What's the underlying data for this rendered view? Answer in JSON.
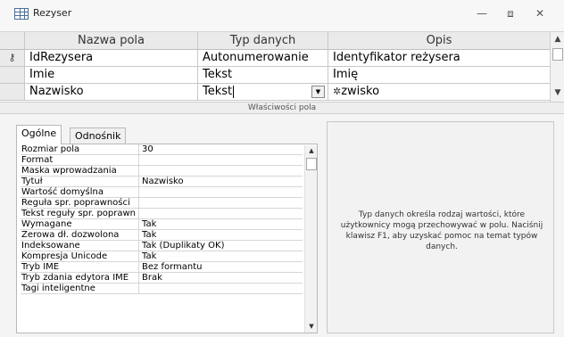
{
  "window": {
    "title": "Rezyser",
    "minimize_glyph": "—",
    "restore_glyph": "⧈",
    "close_glyph": "✕"
  },
  "grid": {
    "headers": [
      "Nazwa pola",
      "Typ danych",
      "Opis"
    ],
    "rows": [
      {
        "key_glyph": "🗝",
        "name": "IdRezysera",
        "type": "Autonumerowanie",
        "desc": "Identyfikator reżysera"
      },
      {
        "key_glyph": "",
        "name": "Imie",
        "type": "Tekst",
        "desc": "Imię"
      },
      {
        "key_glyph": "",
        "name": "Nazwisko",
        "type": "Tekst",
        "desc": "zwisko",
        "desc_prefix_glyph": "✲"
      }
    ]
  },
  "properties_label": "Właściwości pola",
  "tabs": [
    "Ogólne",
    "Odnośnik"
  ],
  "properties": [
    {
      "name": "Rozmiar pola",
      "value": "30"
    },
    {
      "name": "Format",
      "value": ""
    },
    {
      "name": "Maska wprowadzania",
      "value": ""
    },
    {
      "name": "Tytuł",
      "value": "Nazwisko"
    },
    {
      "name": "Wartość domyślna",
      "value": ""
    },
    {
      "name": "Reguła spr. poprawności",
      "value": ""
    },
    {
      "name": "Tekst reguły spr. poprawn",
      "value": ""
    },
    {
      "name": "Wymagane",
      "value": "Tak"
    },
    {
      "name": "Zerowa dł. dozwolona",
      "value": "Tak"
    },
    {
      "name": "Indeksowane",
      "value": "Tak (Duplikaty OK)"
    },
    {
      "name": "Kompresja Unicode",
      "value": "Tak"
    },
    {
      "name": "Tryb IME",
      "value": "Bez formantu"
    },
    {
      "name": "Tryb zdania edytora IME",
      "value": "Brak"
    },
    {
      "name": "Tagi inteligentne",
      "value": ""
    }
  ],
  "help_text": "Typ danych określa rodzaj wartości, które użytkownicy mogą przechowywać w polu. Naciśnij klawisz F1, aby uzyskać pomoc na temat typów danych."
}
